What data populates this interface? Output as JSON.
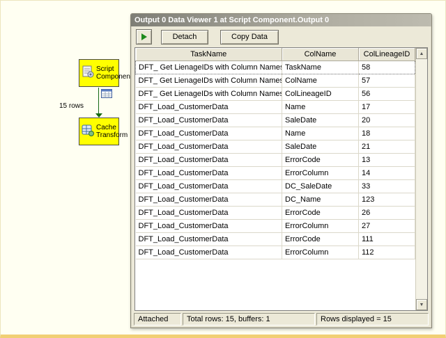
{
  "colors": {
    "task_box": "#ffff00",
    "connector": "#166a16",
    "play_arrow": "#1d8a1d",
    "window_chrome": "#ece9d8",
    "page_background": "#fffff2"
  },
  "icons": {
    "scroll_up": "▲",
    "scroll_down": "▼"
  },
  "diagram": {
    "script_component_label": "Script Component",
    "cache_transform_label": "Cache Transform",
    "rows_label": "15 rows"
  },
  "window": {
    "title": "Output 0 Data Viewer 1 at Script Component.Output 0",
    "toolbar": {
      "detach_label": "Detach",
      "copy_label": "Copy Data"
    },
    "grid": {
      "columns": [
        "TaskName",
        "ColName",
        "ColLineageID"
      ],
      "rows": [
        [
          "DFT_ Get LienageIDs with Column Names",
          "TaskName",
          "58"
        ],
        [
          "DFT_ Get LienageIDs with Column Names",
          "ColName",
          "57"
        ],
        [
          "DFT_ Get LienageIDs with Column Names",
          "ColLineageID",
          "56"
        ],
        [
          "DFT_Load_CustomerData",
          "Name",
          "17"
        ],
        [
          "DFT_Load_CustomerData",
          "SaleDate",
          "20"
        ],
        [
          "DFT_Load_CustomerData",
          "Name",
          "18"
        ],
        [
          "DFT_Load_CustomerData",
          "SaleDate",
          "21"
        ],
        [
          "DFT_Load_CustomerData",
          "ErrorCode",
          "13"
        ],
        [
          "DFT_Load_CustomerData",
          "ErrorColumn",
          "14"
        ],
        [
          "DFT_Load_CustomerData",
          "DC_SaleDate",
          "33"
        ],
        [
          "DFT_Load_CustomerData",
          "DC_Name",
          "123"
        ],
        [
          "DFT_Load_CustomerData",
          "ErrorCode",
          "26"
        ],
        [
          "DFT_Load_CustomerData",
          "ErrorColumn",
          "27"
        ],
        [
          "DFT_Load_CustomerData",
          "ErrorCode",
          "111"
        ],
        [
          "DFT_Load_CustomerData",
          "ErrorColumn",
          "112"
        ]
      ]
    },
    "status": {
      "attached": "Attached",
      "total": "Total rows: 15, buffers: 1",
      "displayed": "Rows displayed = 15"
    }
  }
}
